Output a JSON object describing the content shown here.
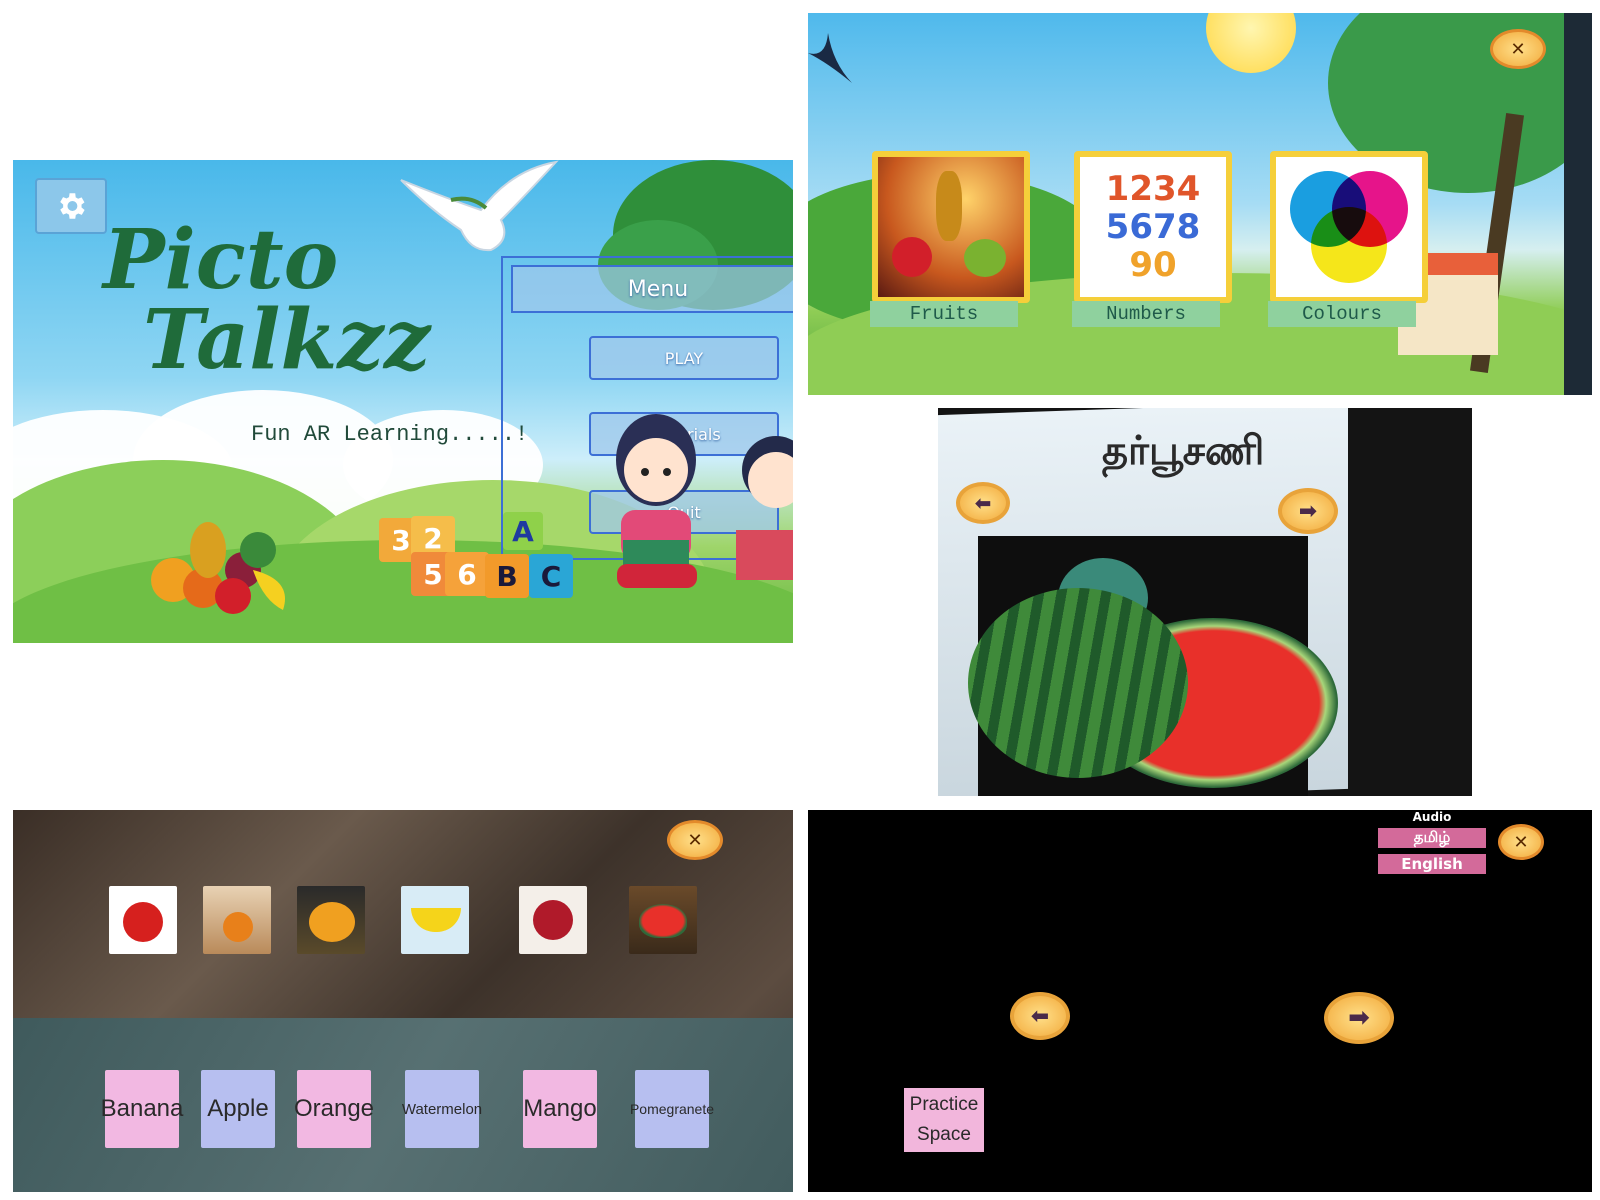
{
  "main_menu": {
    "title_line1": "Picto",
    "title_line2": "Talkzz",
    "tagline": "Fun AR Learning.....!",
    "menu_title": "Menu",
    "play_label": "PLAY",
    "materials_label": "Materials",
    "quit_label": "Quit",
    "blocks": [
      "3",
      "2",
      "5",
      "6",
      "A",
      "B",
      "C"
    ],
    "settings_icon": "gear-icon"
  },
  "categories": {
    "items": [
      {
        "label": "Fruits"
      },
      {
        "label": "Numbers",
        "digits": [
          "1234",
          "5678",
          "90"
        ]
      },
      {
        "label": "Colours"
      }
    ],
    "close_icon": "close-icon"
  },
  "ar_view": {
    "word": "தர்பூசணி",
    "prev_icon": "arrow-left-icon",
    "next_icon": "arrow-right-icon"
  },
  "matching": {
    "thumbnails": [
      "apple",
      "orange",
      "mango",
      "banana",
      "pomegranate",
      "watermelon"
    ],
    "names": [
      {
        "label": "Banana",
        "color": "#f2b8e2"
      },
      {
        "label": "Apple",
        "color": "#b7bff0"
      },
      {
        "label": "Orange",
        "color": "#f2b8e2"
      },
      {
        "label": "Watermelon",
        "color": "#b7bff0"
      },
      {
        "label": "Mango",
        "color": "#f2b8e2"
      },
      {
        "label": "Pomegranete",
        "color": "#b7bff0"
      }
    ]
  },
  "audio_screen": {
    "audio_label": "Audio",
    "tamil_label": "தமிழ்",
    "english_label": "English",
    "practice_line1": "Practice",
    "practice_line2": "Space"
  }
}
